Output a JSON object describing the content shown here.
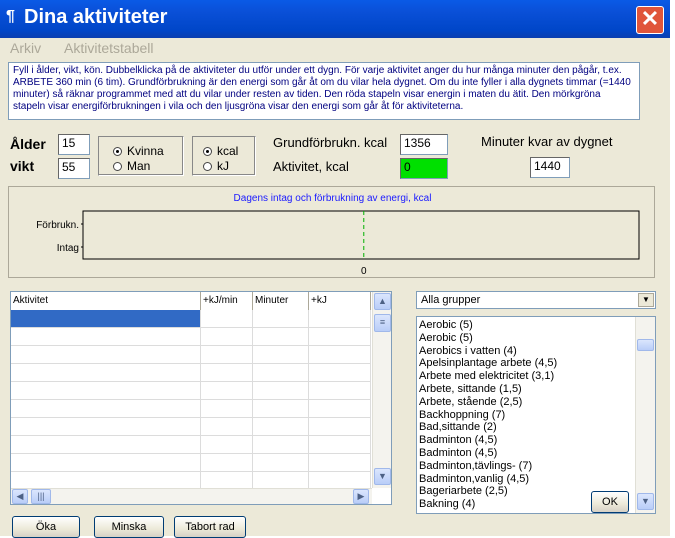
{
  "window": {
    "title": "Dina aktiviteter",
    "close_glyph": "✕"
  },
  "menu": [
    "Arkiv",
    "Aktivitetstabell"
  ],
  "info_text": "Fyll i ålder, vikt, kön. Dubbelklicka på de aktiviteter du utför under ett dygn. För varje aktivitet anger du hur många minuter den pågår, t.ex. ARBETE 360 min (6 tim). Grundförbrukning är den energi som går åt om du vilar hela dygnet. Om du inte fyller i alla dygnets timmar (=1440 minuter) så räknar programmet med att du vilar under resten av tiden. Den röda stapeln visar energin i maten du ätit. Den mörkgröna stapeln visar energiförbrukningen i vila och den ljusgröna visar den energi som går åt för aktiviteterna.",
  "inputs": {
    "age_label": "Ålder",
    "age": "15",
    "weight_label": "vikt",
    "weight": "55"
  },
  "gender": {
    "options": [
      "Kvinna",
      "Man"
    ],
    "selected": "Kvinna"
  },
  "unit": {
    "options": [
      "kcal",
      "kJ"
    ],
    "selected": "kcal"
  },
  "basal": {
    "label": "Grundförbrukn. kcal",
    "value": "1356"
  },
  "activity": {
    "label": "Aktivitet, kcal",
    "value": "0"
  },
  "minutes_left": {
    "label": "Minuter kvar av dygnet",
    "value": "1440"
  },
  "chart_data": {
    "type": "bar",
    "title": "Dagens intag och förbrukning av energi, kcal",
    "categories": [
      "Förbrukn.",
      "Intag"
    ],
    "values": [
      0,
      0
    ],
    "xticks": [
      "0"
    ]
  },
  "table": {
    "columns": [
      "Aktivitet",
      "+kJ/min",
      "Minuter",
      "+kJ"
    ],
    "rows": []
  },
  "group_select": {
    "value": "Alla grupper"
  },
  "activities_list": [
    "Aerobic (5)",
    "Aerobic (5)",
    "Aerobics i vatten (4)",
    "Apelsinplantage arbete (4,5)",
    "Arbete med elektricitet (3,1)",
    "Arbete, sittande (1,5)",
    "Arbete, stående (2,5)",
    "Backhoppning (7)",
    "Bad,sittande (2)",
    "Badminton (4,5)",
    "Badminton (4,5)",
    "Badminton,tävlings- (7)",
    "Badminton,vanlig (4,5)",
    "Bageriarbete (2,5)",
    "Bakning (4)"
  ],
  "buttons": {
    "ok": "OK",
    "increase": "Öka",
    "decrease": "Minska",
    "remove": "Tabort rad"
  },
  "colors": {
    "accent": "#0a50d8",
    "activity_field": "#00e000",
    "chart_title": "#1a1aff",
    "info_text": "#000080"
  }
}
